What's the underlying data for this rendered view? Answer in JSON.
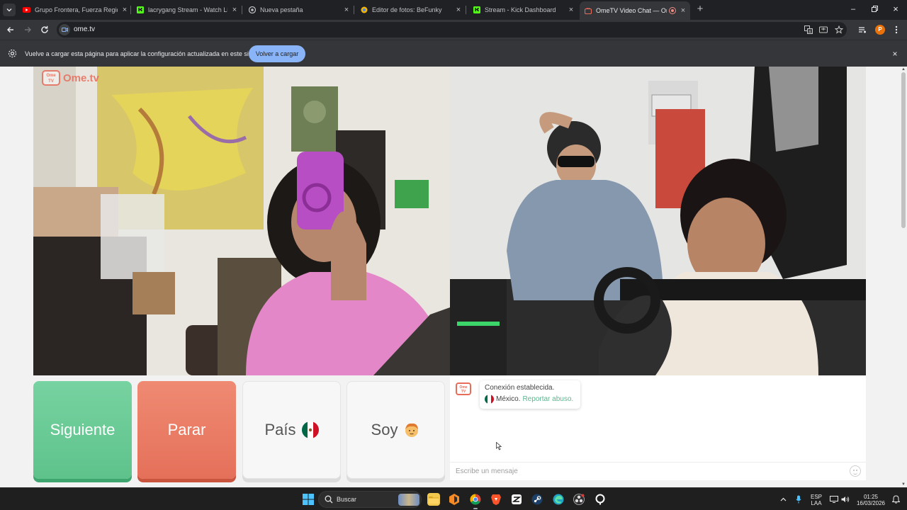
{
  "browser": {
    "tabs": [
      {
        "title": "Grupo Frontera, Fuerza Regida",
        "favicon": "youtube-icon",
        "color": "#ff0000"
      },
      {
        "title": "lacrygang Stream - Watch Live",
        "favicon": "kick-icon",
        "color": "#53fc18"
      },
      {
        "title": "Nueva pestaña",
        "favicon": "chrome-icon",
        "color": "#bdc1c6"
      },
      {
        "title": "Editor de fotos: BeFunky",
        "favicon": "befunky-icon",
        "color": "#f4b400"
      },
      {
        "title": "Stream - Kick Dashboard",
        "favicon": "kick-icon",
        "color": "#53fc18"
      },
      {
        "title": "OmeTV Video Chat — Ome",
        "favicon": "ometv-icon",
        "color": "#e86c5a",
        "active": true
      }
    ],
    "url": "ome.tv",
    "profile_initial": "P",
    "infobar": {
      "message": "Vuelve a cargar esta página para aplicar la configuración actualizada en este sitio",
      "button": "Volver a cargar"
    }
  },
  "ometv": {
    "logo_text": "Ome.tv",
    "logo_mini": "Ome TV",
    "buttons": {
      "next": "Siguiente",
      "stop": "Parar",
      "country": "País",
      "gender": "Soy"
    },
    "chat": {
      "status": "Conexión establecida.",
      "country": "México.",
      "report": "Reportar abuso.",
      "placeholder": "Escribe un mensaje"
    },
    "colors": {
      "next": "#5ec28b",
      "stop": "#e5705a",
      "accent": "#e86c5a"
    }
  },
  "taskbar": {
    "search_label": "Buscar",
    "language": "ESP",
    "layout": "LAA",
    "time": "01:25",
    "date": "16/03/2026"
  }
}
